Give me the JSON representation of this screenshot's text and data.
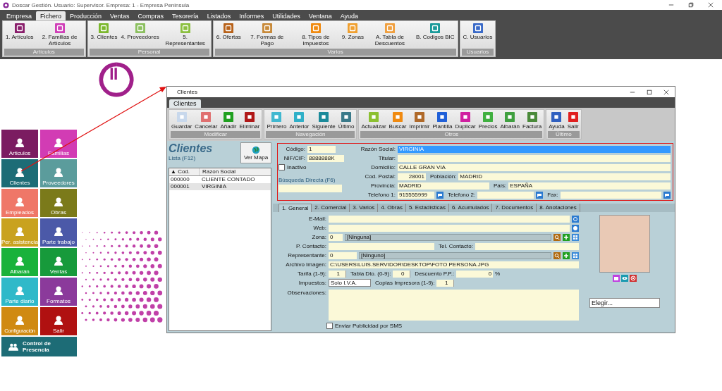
{
  "window": {
    "title": "Doscar Gestión. Usuario: Supervisor. Empresa: 1 - Empresa Peninsula"
  },
  "menu": [
    {
      "label": "Empresa",
      "selected": false
    },
    {
      "label": "Fichero",
      "selected": true
    },
    {
      "label": "Producción",
      "selected": false
    },
    {
      "label": "Ventas",
      "selected": false
    },
    {
      "label": "Compras",
      "selected": false
    },
    {
      "label": "Tesorería",
      "selected": false
    },
    {
      "label": "Listados",
      "selected": false
    },
    {
      "label": "Informes",
      "selected": false
    },
    {
      "label": "Utilidades",
      "selected": false
    },
    {
      "label": "Ventana",
      "selected": false
    },
    {
      "label": "Ayuda",
      "selected": false
    }
  ],
  "ribbon": [
    {
      "title": "Artículos",
      "items": [
        "1. Artículos",
        "2. Familias de Artículos"
      ]
    },
    {
      "title": "Personal",
      "items": [
        "3. Clientes",
        "4. Proveedores",
        "5. Representantes"
      ]
    },
    {
      "title": "Varios",
      "items": [
        "6. Ofertas",
        "7. Formas de Pago",
        "8. Tipos de Impuestos",
        "9. Zonas",
        "A. Tabla de Descuentos",
        "B. Codigos BIC"
      ]
    },
    {
      "title": "Usuarios",
      "items": [
        "C. Usuarios"
      ]
    }
  ],
  "tiles": [
    {
      "label": "Articulos",
      "color": "#7b1c61"
    },
    {
      "label": "Familias",
      "color": "#d23cb4"
    },
    {
      "label": "Clientes",
      "color": "#1d6c76"
    },
    {
      "label": "Proveedores",
      "color": "#5b9c9c"
    },
    {
      "label": "Empleados",
      "color": "#ef7768"
    },
    {
      "label": "Obras",
      "color": "#7b7a1a"
    },
    {
      "label": "Per. asistencia",
      "color": "#c9a21f"
    },
    {
      "label": "Parte trabajo",
      "color": "#4b59a8"
    },
    {
      "label": "Albarán",
      "color": "#19b23b"
    },
    {
      "label": "Ventas",
      "color": "#179a3b"
    },
    {
      "label": "Parte diario",
      "color": "#2fb9c9"
    },
    {
      "label": "Formatos",
      "color": "#8b3a9b"
    },
    {
      "label": "Configuración",
      "color": "#d08a12"
    },
    {
      "label": "Salir",
      "color": "#b01111"
    }
  ],
  "presence_button": {
    "label": "Control de Presencia"
  },
  "clients_window": {
    "title": "Clientes",
    "tab": {
      "label": "Clientes",
      "selected": true
    },
    "toolbar": [
      {
        "title": "Modificar",
        "items": [
          "Guardar",
          "Cancelar",
          "Añadir",
          "Eliminar"
        ]
      },
      {
        "title": "Navegación",
        "items": [
          "Primero",
          "Anterior",
          "Siguiente",
          "Último"
        ]
      },
      {
        "title": "Otros",
        "items": [
          "Actualizar",
          "Buscar",
          "Imprimir",
          "Plantilla",
          "Duplicar",
          "Precios",
          "Albarán",
          "Factura"
        ]
      },
      {
        "title": "Último",
        "items": [
          "Ayuda",
          "Salir"
        ]
      }
    ],
    "list_panel": {
      "title": "Clientes",
      "subtitle": "Lista (F12)",
      "map_button": "Ver Mapa",
      "columns": [
        "▲ Cod.",
        "Razon Social"
      ],
      "rows": [
        {
          "code": "000000",
          "name": "CLIENTE CONTADO",
          "selected": false
        },
        {
          "code": "000001",
          "name": "VIRGINIA",
          "selected": true
        }
      ],
      "search_label": "Búsqueda Directa (F6)"
    },
    "header": {
      "code": {
        "label": "Código:",
        "value": "1"
      },
      "nif": {
        "label": "NIF/CIF:",
        "value": "8888888K"
      },
      "inactive": {
        "label": "Inactivo",
        "checked": false
      },
      "business_name": {
        "label": "Razón Social:",
        "value": "VIRGINIA",
        "selected": true
      },
      "holder": {
        "label": "Titular:"
      },
      "address": {
        "label": "Domicilio:",
        "value": "CALLE GRAN VIA"
      },
      "postal_code": {
        "label": "Cod. Postal:",
        "value": "28001"
      },
      "city": {
        "label": "Población:",
        "value": "MADRID"
      },
      "province": {
        "label": "Provincia:",
        "value": "MADRID"
      },
      "country": {
        "label": "País:",
        "value": "ESPAÑA"
      },
      "phone1": {
        "label": "Telefono 1:",
        "value": "915555999"
      },
      "phone2": {
        "label": "Telefono 2:"
      },
      "fax": {
        "label": "Fax:"
      }
    },
    "tabs": [
      {
        "label": "1. General",
        "selected": true
      },
      {
        "label": "2. Comercial",
        "selected": false
      },
      {
        "label": "3. Varios",
        "selected": false
      },
      {
        "label": "4. Obras",
        "selected": false
      },
      {
        "label": "5. Estadísticas",
        "selected": false
      },
      {
        "label": "6. Acumulados",
        "selected": false
      },
      {
        "label": "7. Documentos",
        "selected": false
      },
      {
        "label": "8. Anotaciones",
        "selected": false
      }
    ],
    "general": {
      "email": {
        "label": "E-Mail:"
      },
      "web": {
        "label": "Web:"
      },
      "zone": {
        "label": "Zona:",
        "value": "0",
        "name": "[Ninguna]"
      },
      "contact": {
        "label": "P. Contacto:"
      },
      "contact_phone": {
        "label": "Tel. Contacto:"
      },
      "representative": {
        "label": "Representante:",
        "value": "0",
        "name": "[Ninguno]"
      },
      "image_file": {
        "label": "Archivo Imagen:",
        "value": "C:\\USERS\\LUIS.SERVIDOR\\DESKTOP\\FOTO PERSONA.JPG"
      },
      "rate": {
        "label": "Tarifa (1-9):",
        "value": "1"
      },
      "discount_table": {
        "label": "Tabla Dto. (0-9):",
        "value": "0"
      },
      "discount_pp": {
        "label": "Descuento P.P.:",
        "value": "0",
        "unit": "%"
      },
      "taxes": {
        "label": "Impuestos:",
        "value": "Solo I.V.A."
      },
      "copies": {
        "label": "Copias Impresora (1-9):",
        "value": "1"
      },
      "notes": {
        "label": "Observaciones:"
      },
      "sms": {
        "label": "Enviar Publicidad por SMS",
        "checked": false
      },
      "choose": {
        "value": "Elegir..."
      }
    }
  }
}
